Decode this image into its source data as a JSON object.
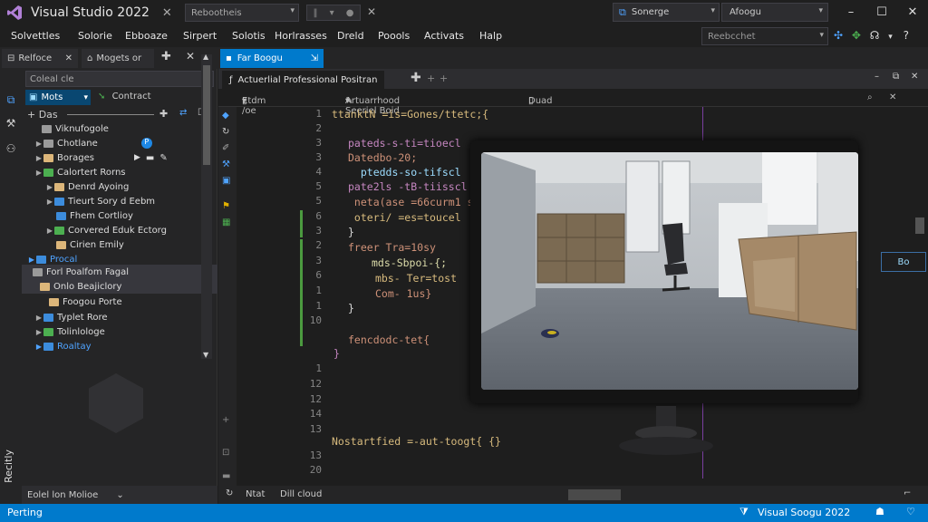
{
  "titlebar": {
    "app_title": "Visual Studio 2022",
    "config_dropdown": "Rebootheis",
    "search_value": "Sonerge",
    "profile_dropdown": "Afoogu",
    "min_glyph": "–",
    "max_glyph": "☐",
    "close_glyph": "✕"
  },
  "menu": {
    "items": [
      "Solvettles",
      "Solorie",
      "Ebboaze",
      "Sirpert",
      "Solotis",
      "Horlrasses",
      "Dreld",
      "Poools",
      "Activats",
      "Halp"
    ],
    "search_placeholder": "Reebcchet"
  },
  "tabs": {
    "explorer_tab": "Relfoce",
    "explorer_tab2": "Mogets or",
    "editor_tab": "Far Boogu"
  },
  "explorer": {
    "search": "Coleal cle",
    "toolbar_btn": "Mots",
    "toolbar_btn2": "Contract",
    "root_label": "+ Das",
    "items": [
      {
        "label": "Viknufogole",
        "color": "grey"
      },
      {
        "label": "Chotlane",
        "color": "grey"
      },
      {
        "label": "Borages",
        "color": "yellow"
      },
      {
        "label": "Calortert Rorns",
        "color": "green"
      },
      {
        "label": "Denrd Ayoing",
        "color": "yellow"
      },
      {
        "label": "Tieurt Sory d Eebm",
        "color": "blue"
      },
      {
        "label": "Fhem Cortlioy",
        "color": "blue"
      },
      {
        "label": "Corvered Eduk Ectorg",
        "color": "green"
      },
      {
        "label": "Cirien Emily",
        "color": "yellow"
      },
      {
        "label": "Procal",
        "color": "blue"
      },
      {
        "label": "Forl Poalfom Fagal",
        "color": "grey"
      },
      {
        "label": "Onlo Beajiclory",
        "color": "yellow"
      },
      {
        "label": "Foogou Porte",
        "color": "yellow"
      },
      {
        "label": "Typlet Rore",
        "color": "blue"
      },
      {
        "label": "Tolinlologe",
        "color": "green"
      },
      {
        "label": "Roaltay",
        "color": "blue"
      }
    ],
    "bottom_label": "Eolel lon Molioe"
  },
  "activity": {
    "vertical_label": "Recitly"
  },
  "editor": {
    "tab_title": "Actuerlial Professional Positran",
    "nav_left": "Etdm /oe",
    "nav_mid": "Artuarrhood Seeriel Boid",
    "nav_right": "Duad",
    "status_left": "Ntat",
    "status_mid": "Dill cloud",
    "line_numbers": [
      "1",
      "2",
      "3",
      "3",
      "4",
      "5",
      "5",
      "6",
      "3",
      "2",
      "3",
      "6",
      "1",
      "1",
      "10",
      "1",
      "12",
      "12",
      "14",
      "13",
      "13",
      "20"
    ],
    "code_lines": [
      {
        "text": "ttanktN =is=Gones/ttetc;{",
        "color": "#d7ba7d",
        "indent": 0
      },
      {
        "text": "pateds-s-ti=tioecl",
        "color": "#c586c0",
        "indent": 1
      },
      {
        "text": "Datedbo-20;",
        "color": "#ce9178",
        "indent": 1
      },
      {
        "text": "  ptedds-so-tifscl",
        "color": "#9cdcfe",
        "indent": 1
      },
      {
        "text": "pate2ls -tB-tiisscl",
        "color": "#c586c0",
        "indent": 1
      },
      {
        "text": " neta(ase =66curm1 seda: 2022",
        "color": "#ce9178",
        "indent": 1
      },
      {
        "text": " oteri/ =es=toucel",
        "color": "#d7ba7d",
        "indent": 1
      },
      {
        "text": "}",
        "color": "#dddddd",
        "indent": 1
      },
      {
        "text": "freer Tra=10sy",
        "color": "#ce9178",
        "indent": 1
      },
      {
        "text": "mds-Sbpoi-{;",
        "color": "#dcdcaa",
        "indent": 2
      },
      {
        "text": "mbs- Ter=tost",
        "color": "#d7ba7d",
        "indent": 2
      },
      {
        "text": "Com- 1us}",
        "color": "#ce9178",
        "indent": 2
      },
      {
        "text": "}",
        "color": "#dddddd",
        "indent": 1
      },
      {
        "text": "",
        "color": "#dddddd",
        "indent": 0
      },
      {
        "text": "fencdodc-tet{",
        "color": "#ce9178",
        "indent": 1
      },
      {
        "text": "}",
        "color": "#c586c0",
        "indent": 0
      },
      {
        "text": "Nostartfied =-aut-toogt{ {}",
        "color": "#d7ba7d",
        "indent": 0
      }
    ],
    "side_box": "Bo"
  },
  "statusbar": {
    "left": "Perting",
    "right": "Visual Soogu 2022"
  },
  "colors": {
    "accent": "#007acc",
    "background": "#1e1e1e",
    "panel": "#252526"
  }
}
